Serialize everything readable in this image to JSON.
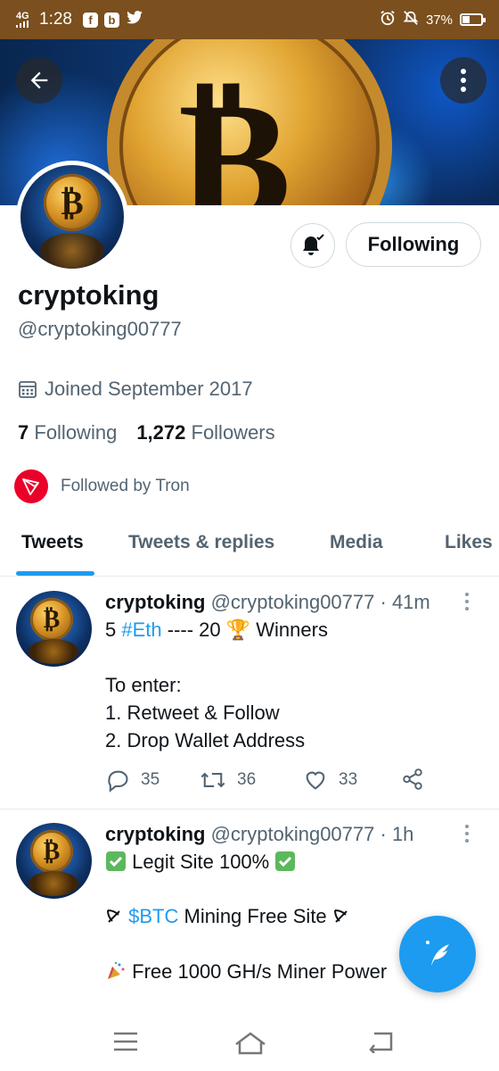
{
  "status_bar": {
    "network": "4G",
    "time": "1:28",
    "apps": [
      "f",
      "b"
    ],
    "battery": "37%"
  },
  "colors": {
    "accent": "#1d9bf0",
    "status_bar": "#7b4f1e",
    "tron_red": "#eb0029",
    "secondary_text": "#536471"
  },
  "header": {
    "back_icon": "arrow-left-icon",
    "menu_icon": "more-vertical-icon"
  },
  "profile": {
    "name": "cryptoking",
    "handle": "@cryptoking00777",
    "joined": "Joined September 2017",
    "following_count": "7",
    "following_label": "Following",
    "followers_count": "1,272",
    "followers_label": "Followers",
    "followed_by": "Followed by Tron",
    "follow_button": "Following",
    "bell_icon": "bell-subscribed-icon"
  },
  "tabs": [
    {
      "label": "Tweets",
      "active": true
    },
    {
      "label": "Tweets & replies",
      "active": false
    },
    {
      "label": "Media",
      "active": false
    },
    {
      "label": "Likes",
      "active": false
    }
  ],
  "tweets": [
    {
      "name": "cryptoking",
      "handle": "@cryptoking00777",
      "time": "41m",
      "line1_pre": "5 ",
      "line1_hash": "#Eth",
      "line1_mid": " ---- 20 ",
      "line1_emoji": "🏆",
      "line1_post": " Winners",
      "line2": "To enter:",
      "line3": "1. Retweet & Follow",
      "line4": "2. Drop Wallet Address",
      "replies": "35",
      "retweets": "36",
      "likes": "33"
    },
    {
      "name": "cryptoking",
      "handle": "@cryptoking00777",
      "time": "1h",
      "line1": "Legit Site 100%",
      "line2_pre": " ",
      "line2_hash": "$BTC",
      "line2_post": " Mining Free Site ",
      "line3": "Free 1000 GH/s Miner Power"
    }
  ],
  "fab_icon": "compose-tweet-icon",
  "navbar_icons": [
    "menu-icon",
    "home-icon",
    "back-icon"
  ]
}
